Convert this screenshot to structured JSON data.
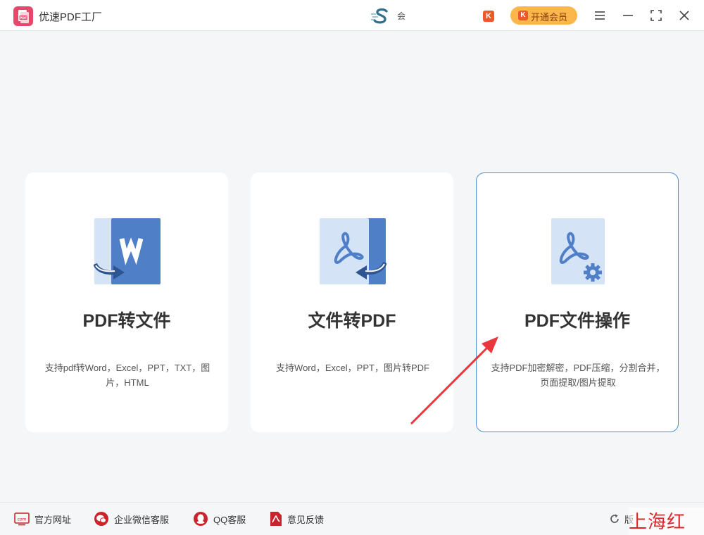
{
  "window": {
    "title": "优速PDF工厂",
    "center_text": "会",
    "vip_button_label": "开通会员",
    "k_badge": "K"
  },
  "cards": [
    {
      "title": "PDF转文件",
      "description": "支持pdf转Word，Excel，PPT，TXT，图片，HTML",
      "icon": "pdf-to-word-icon"
    },
    {
      "title": "文件转PDF",
      "description": "支持Word，Excel，PPT，图片转PDF",
      "icon": "file-to-pdf-icon"
    },
    {
      "title": "PDF文件操作",
      "description": "支持PDF加密解密，PDF压缩，分割合并，页面提取/图片提取",
      "icon": "pdf-operations-icon",
      "selected": true
    }
  ],
  "footer": {
    "links": [
      {
        "label": "官方网址",
        "icon": "website-icon"
      },
      {
        "label": "企业微信客服",
        "icon": "wechat-service-icon"
      },
      {
        "label": "QQ客服",
        "icon": "qq-icon"
      },
      {
        "label": "意见反馈",
        "icon": "feedback-icon"
      }
    ],
    "version_label": "版",
    "watermark": "上海红网"
  },
  "colors": {
    "accent_blue": "#4a90d9",
    "icon_blue": "#4f7fc7",
    "icon_light": "#d5e3f7",
    "vip_orange": "#fbb74b",
    "brand_pink": "#e8466b",
    "arrow_red": "#e8383d"
  }
}
